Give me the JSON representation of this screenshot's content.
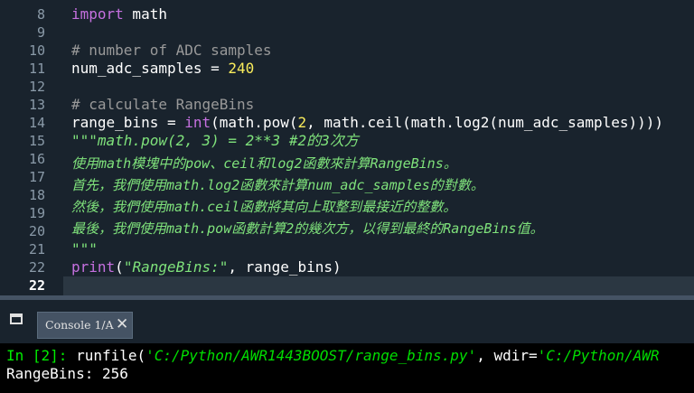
{
  "editor": {
    "line_numbers": [
      "8",
      "9",
      "10",
      "11",
      "12",
      "13",
      "14",
      "15",
      "16",
      "17",
      "18",
      "19",
      "20",
      "21",
      "22",
      "22"
    ],
    "current_line": "22",
    "lines": {
      "l8": {
        "kw": "import",
        "rest": " math"
      },
      "l10": {
        "comment": "# number of ADC samples"
      },
      "l11": {
        "var": "num_adc_samples = ",
        "num": "240"
      },
      "l13": {
        "comment": "# calculate RangeBins"
      },
      "l14": {
        "a": "range_bins = ",
        "bi": "int",
        "b": "(math.pow(",
        "num": "2",
        "c": ", math.ceil(math.log2(num_adc_samples))))"
      },
      "l15": "\"\"\"math.pow(2, 3) = 2**3 #2的3次方",
      "l16": "使用math模塊中的pow、ceil和log2函數來計算RangeBins。",
      "l17": "首先，我們使用math.log2函數來計算num_adc_samples的對數。",
      "l18": "然後，我們使用math.ceil函數將其向上取整到最接近的整數。",
      "l19": "最後，我們使用math.pow函數計算2的幾次方，以得到最終的RangeBins值。",
      "l20": "\"\"\"",
      "l22": {
        "bi": "print",
        "a": "(",
        "str": "\"RangeBins:\"",
        "b": ", range_bins)"
      }
    }
  },
  "console": {
    "tab_label": "Console 1/A",
    "close_glyph": "✕",
    "pane_icon": "window-icon",
    "prompt": "In [2]:",
    "cmd_a": " runfile(",
    "cmd_path": "'C:/Python/AWR1443BOOST/range_bins.py'",
    "cmd_b": ", wdir=",
    "cmd_wdir": "'C:/Python/AWR",
    "output": "RangeBins: 256"
  },
  "colors": {
    "editor_bg": "#19232d",
    "keyword": "#c670e0",
    "number": "#faed5c",
    "comment": "#999999",
    "string": "#7fe27b",
    "console_bg": "#000000",
    "prompt": "#00ee00"
  }
}
